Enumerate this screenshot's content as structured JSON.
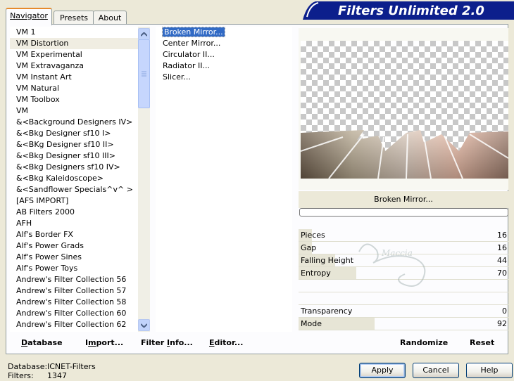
{
  "window": {
    "title": "Filters Unlimited 2.0"
  },
  "tabs": [
    {
      "label": "Navigator",
      "active": true
    },
    {
      "label": "Presets",
      "active": false
    },
    {
      "label": "About",
      "active": false
    }
  ],
  "categories": [
    "VM 1",
    "VM Distortion",
    "VM Experimental",
    "VM Extravaganza",
    "VM Instant Art",
    "VM Natural",
    "VM Toolbox",
    "VM",
    "&<Background Designers IV>",
    "&<Bkg Designer sf10 I>",
    "&<BKg Designer sf10 II>",
    "&<Bkg Designer sf10 III>",
    "&<Bkg Designers sf10 IV>",
    "&<Bkg Kaleidoscope>",
    "&<Sandflower Specials^v^ >",
    "[AFS IMPORT]",
    "AB Filters 2000",
    "AFH",
    "Alf's Border FX",
    "Alf's Power Grads",
    "Alf's Power Sines",
    "Alf's Power Toys",
    "Andrew's Filter Collection 56",
    "Andrew's Filter Collection 57",
    "Andrew's Filter Collection 58",
    "Andrew's Filter Collection 60",
    "Andrew's Filter Collection 62"
  ],
  "selected_category": "VM Distortion",
  "filters": [
    "Broken Mirror...",
    "Center Mirror...",
    "Circulator II...",
    "Radiator II...",
    "Slicer..."
  ],
  "selected_filter": "Broken Mirror...",
  "preview": {
    "filter_name": "Broken Mirror...",
    "watermark": "Maccia"
  },
  "parameters": [
    {
      "label": "Pieces",
      "value": "16",
      "level": 0.063
    },
    {
      "label": "Gap",
      "value": "16",
      "level": 0.063
    },
    {
      "label": "Falling Height",
      "value": "44",
      "level": 0.173
    },
    {
      "label": "Entropy",
      "value": "70",
      "level": 0.275
    },
    {
      "label": "",
      "value": "",
      "level": 0
    },
    {
      "label": "",
      "value": "",
      "level": 0
    },
    {
      "label": "Transparency",
      "value": "0",
      "level": 0
    },
    {
      "label": "Mode",
      "value": "92",
      "level": 0.361
    }
  ],
  "toolbar": {
    "database_u": "D",
    "database_rest": "atabase",
    "import_pre": "I",
    "import_u": "m",
    "import_rest": "port...",
    "filterinfo_pre": "Filter ",
    "filterinfo_u": "I",
    "filterinfo_rest": "nfo...",
    "editor_u": "E",
    "editor_rest": "ditor...",
    "randomize": "Randomize",
    "reset": "Reset"
  },
  "status": {
    "database_label": "Database:",
    "database_value": "ICNET-Filters",
    "filters_label": "Filters:",
    "filters_value": "1347"
  },
  "buttons": {
    "apply": "Apply",
    "cancel": "Cancel",
    "help": "Help"
  },
  "colors": {
    "banner": "#0c1f8c",
    "selection": "#316ac5",
    "tab_highlight": "#e68b2c"
  }
}
